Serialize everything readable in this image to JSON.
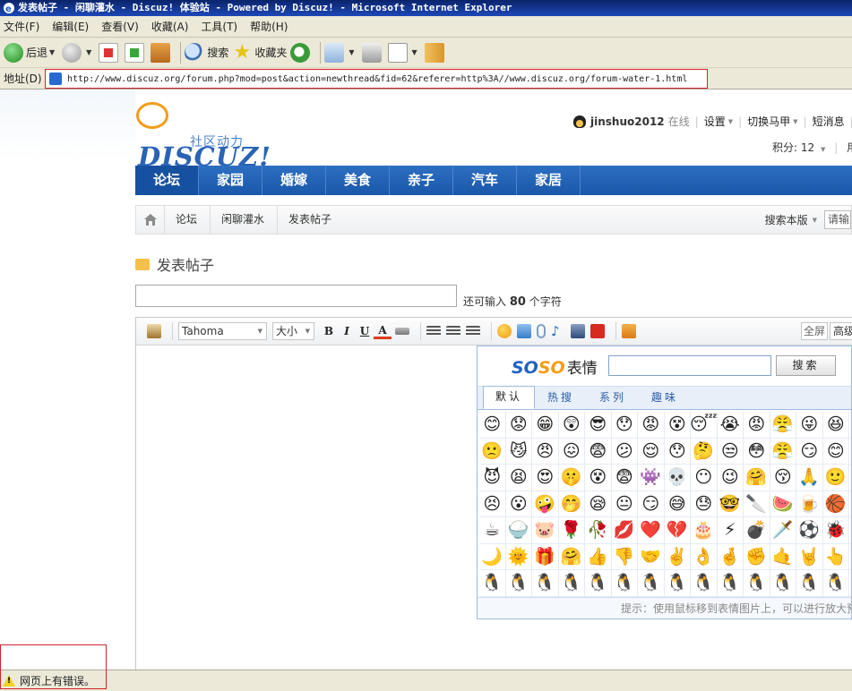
{
  "window": {
    "title": "发表帖子 - 闲聊灌水 - Discuz! 体验站 - Powered by Discuz! - Microsoft Internet Explorer"
  },
  "menubar": {
    "items": [
      {
        "label": "文件(F)"
      },
      {
        "label": "编辑(E)"
      },
      {
        "label": "查看(V)"
      },
      {
        "label": "收藏(A)"
      },
      {
        "label": "工具(T)"
      },
      {
        "label": "帮助(H)"
      }
    ]
  },
  "toolbar": {
    "back_label": "后退",
    "search_label": "搜索",
    "favorites_label": "收藏夹"
  },
  "address": {
    "label": "地址(D)",
    "url": "http://www.discuz.org/forum.php?mod=post&action=newthread&fid=62&referer=http%3A//www.discuz.org/forum-water-1.html"
  },
  "site": {
    "slogan": "社区动力",
    "brand": "DISCUZ!",
    "user": {
      "username": "jinshuo2012",
      "status": "在线",
      "links": [
        "设置",
        "切换马甲",
        "短消息"
      ],
      "credits_label": "积分: 12",
      "user_group": "用户"
    },
    "nav": [
      "论坛",
      "家园",
      "婚嫁",
      "美食",
      "亲子",
      "汽车",
      "家居"
    ],
    "breadcrumb": [
      "论坛",
      "闲聊灌水",
      "发表帖子"
    ],
    "search_board_label": "搜索本版",
    "search_placeholder": "请输入"
  },
  "post_form": {
    "title": "发表帖子",
    "subject_value": "",
    "remaining_prefix": "还可输入",
    "remaining_count": "80",
    "remaining_suffix": "个字符"
  },
  "editor": {
    "font_family": "Tahoma",
    "font_size": "大小",
    "bold": "B",
    "italic": "I",
    "underline": "U",
    "color": "A",
    "fullscreen_label": "全屏",
    "advanced_label": "高级"
  },
  "emoji_panel": {
    "logo_1": "SO",
    "logo_2": "SO",
    "logo_3": "表情",
    "search_value": "",
    "search_button": "搜索",
    "tabs": [
      "默认",
      "热搜",
      "系列",
      "趣味"
    ],
    "emojis": [
      [
        "😊",
        "😟",
        "😁",
        "😲",
        "😎",
        "😯",
        "😡",
        "😵",
        "😴",
        "😭",
        "😡",
        "😤",
        "😜",
        "😆"
      ],
      [
        "🙁",
        "😼",
        "😠",
        "😖",
        "😨",
        "😕",
        "😌",
        "😯",
        "🤔",
        "😒",
        "😳",
        "😤",
        "😏",
        "😊"
      ],
      [
        "😈",
        "😫",
        "😍",
        "🤫",
        "😵",
        "😨",
        "👾",
        "💀",
        "😶",
        "😉",
        "🤗",
        "😚",
        "🙏",
        "🙂"
      ],
      [
        "😣",
        "😮",
        "🤪",
        "🤭",
        "😪",
        "😐",
        "😏",
        "😅",
        "😓",
        "🤓",
        "🔪",
        "🍉",
        "🍺",
        "🏀"
      ],
      [
        "☕",
        "🍚",
        "🐷",
        "🌹",
        "🥀",
        "💋",
        "❤️",
        "💔",
        "🎂",
        "⚡",
        "💣",
        "🗡️",
        "⚽",
        "🐞"
      ],
      [
        "🌙",
        "🌞",
        "🎁",
        "🤗",
        "👍",
        "👎",
        "🤝",
        "✌️",
        "👌",
        "🤞",
        "✊",
        "🤙",
        "🤘",
        "👆"
      ],
      [
        "🐧",
        "🐧",
        "🐧",
        "🐧",
        "🐧",
        "🐧",
        "🐧",
        "🐧",
        "🐧",
        "🐧",
        "🐧",
        "🐧",
        "🐧",
        "🐧"
      ]
    ],
    "hint": "提示：使用鼠标移到表情图片上，可以进行放大预览"
  },
  "status": {
    "text": "网页上有错误。"
  },
  "colors": {
    "nav_blue": "#1a57a8",
    "highlight_red": "#d4222a",
    "ie_chrome": "#ece9d8"
  }
}
